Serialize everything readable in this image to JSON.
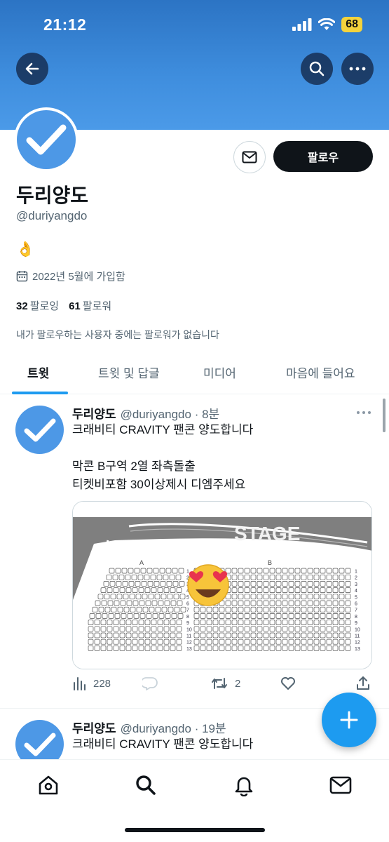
{
  "status_bar": {
    "time": "21:12",
    "battery": "68"
  },
  "profile": {
    "display_name": "두리양도",
    "handle": "@duriyangdo",
    "bio": "👌",
    "joined": "2022년 5월에 가입함",
    "following_count": "32",
    "following_label": "팔로잉",
    "followers_count": "61",
    "followers_label": "팔로워",
    "no_mutual_followers": "내가 팔로우하는 사용자 중에는 팔로워가 없습니다",
    "follow_label": "팔로우"
  },
  "tabs": [
    {
      "label": "트윗",
      "active": true
    },
    {
      "label": "트윗 및 답글",
      "active": false
    },
    {
      "label": "미디어",
      "active": false
    },
    {
      "label": "마음에 들어요",
      "active": false
    }
  ],
  "tweets": [
    {
      "name": "두리양도",
      "handle": "@duriyangdo",
      "time": "· 8분",
      "text": "크래비티 CRAVITY 팬콘 양도합니다\n\n막콘 B구역 2열 좌측돌출\n티켓비포함 30이상제시 디엠주세요",
      "media": {
        "stage_label": "STAGE",
        "section_a": "A",
        "section_b": "B",
        "row_numbers": [
          "1",
          "2",
          "3",
          "4",
          "5",
          "6",
          "7",
          "8",
          "9",
          "10",
          "11",
          "12",
          "13"
        ]
      },
      "views": "228",
      "retweets": "2"
    },
    {
      "name": "두리양도",
      "handle": "@duriyangdo",
      "time": "· 19분",
      "text": "크래비티 CRAVITY 팬콘 양도합니다"
    }
  ],
  "colors": {
    "accent": "#1d9bf0",
    "banner": "#3f8ede",
    "avatar": "#4d98e6"
  },
  "icons": {
    "back": "arrow-left-icon",
    "search": "search-icon",
    "more": "more-icon",
    "message": "mail-icon",
    "calendar": "calendar-icon",
    "views": "bar-chart-icon",
    "reply": "reply-icon",
    "retweet": "retweet-icon",
    "like": "heart-icon",
    "share": "share-icon",
    "compose": "plus-icon",
    "home": "home-icon",
    "notifications": "bell-icon"
  }
}
